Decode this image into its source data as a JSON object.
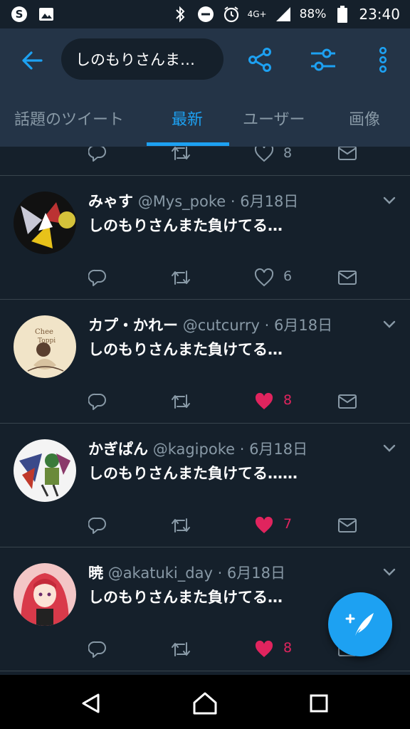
{
  "status_bar": {
    "network": "4G+",
    "battery": "88%",
    "time": "23:40",
    "icons": [
      "skype-icon",
      "image-icon",
      "bluetooth-icon",
      "do-not-disturb-icon",
      "alarm-icon",
      "signal-icon",
      "battery-icon"
    ]
  },
  "header": {
    "search_query": "しのもりさんま…"
  },
  "tabs": [
    "話題のツイート",
    "最新",
    "ユーザー",
    "画像"
  ],
  "active_tab": "最新",
  "partial_tweet": {
    "like_count": "8"
  },
  "tweets": [
    {
      "name": "みゃす",
      "handle": "@Mys_poke",
      "date": "· 6月18日",
      "text": "しのもりさんまた負けてる…",
      "like_count": "6",
      "liked": false
    },
    {
      "name": "カプ・かれー",
      "handle": "@cutcurry",
      "date": "· 6月18日",
      "text": "しのもりさんまた負けてる…",
      "like_count": "8",
      "liked": true
    },
    {
      "name": "かぎぱん",
      "handle": "@kagipoke",
      "date": "· 6月18日",
      "text": "しのもりさんまた負けてる……",
      "like_count": "7",
      "liked": true
    },
    {
      "name": "暁",
      "handle": "@akatuki_day",
      "date": "· 6月18日",
      "text": "しのもりさんまた負けてる…",
      "like_count": "8",
      "liked": true
    }
  ],
  "colors": {
    "background": "#15202b",
    "header": "#243447",
    "accent": "#1da1f2",
    "like": "#e0245e",
    "muted": "#8899a6"
  }
}
